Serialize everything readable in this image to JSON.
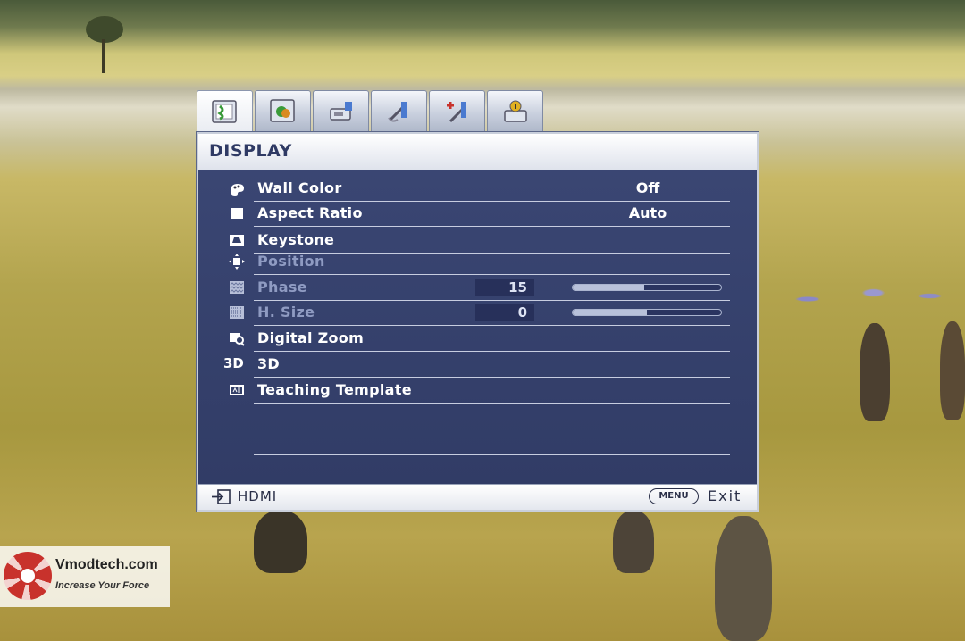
{
  "watermark": {
    "site": "Vmodtech.com",
    "tagline": "Increase Your Force"
  },
  "tabs": [
    {
      "icon": "display-settings-icon",
      "active": true
    },
    {
      "icon": "picture-settings-icon",
      "active": false
    },
    {
      "icon": "source-settings-icon",
      "active": false
    },
    {
      "icon": "system-setup-basic-icon",
      "active": false
    },
    {
      "icon": "system-setup-advanced-icon",
      "active": false
    },
    {
      "icon": "information-icon",
      "active": false
    }
  ],
  "panel": {
    "title": "DISPLAY",
    "items": [
      {
        "label": "Wall Color",
        "value": "Off",
        "icon": "wall-color-icon"
      },
      {
        "label": "Aspect Ratio",
        "value": "Auto",
        "icon": "aspect-ratio-icon"
      },
      {
        "label": "Keystone",
        "icon": "keystone-icon"
      },
      {
        "label": "Position",
        "icon": "position-icon",
        "disabled": true
      },
      {
        "label": "Phase",
        "number": "15",
        "level": 0.48,
        "icon": "phase-icon",
        "disabled": true
      },
      {
        "label": "H. Size",
        "number": "0",
        "level": 0.5,
        "icon": "h-size-icon",
        "disabled": true
      },
      {
        "label": "Digital Zoom",
        "icon": "digital-zoom-icon"
      },
      {
        "label": "3D",
        "icon": "3d-icon"
      },
      {
        "label": "Teaching Template",
        "icon": "teaching-template-icon"
      }
    ]
  },
  "footer": {
    "source": "HDMI",
    "menu_button": "MENU",
    "exit": "Exit"
  },
  "colors": {
    "panel_bg": "#34406a",
    "header_title": "#2f3a64",
    "disabled_text": "#8f9bc2"
  }
}
